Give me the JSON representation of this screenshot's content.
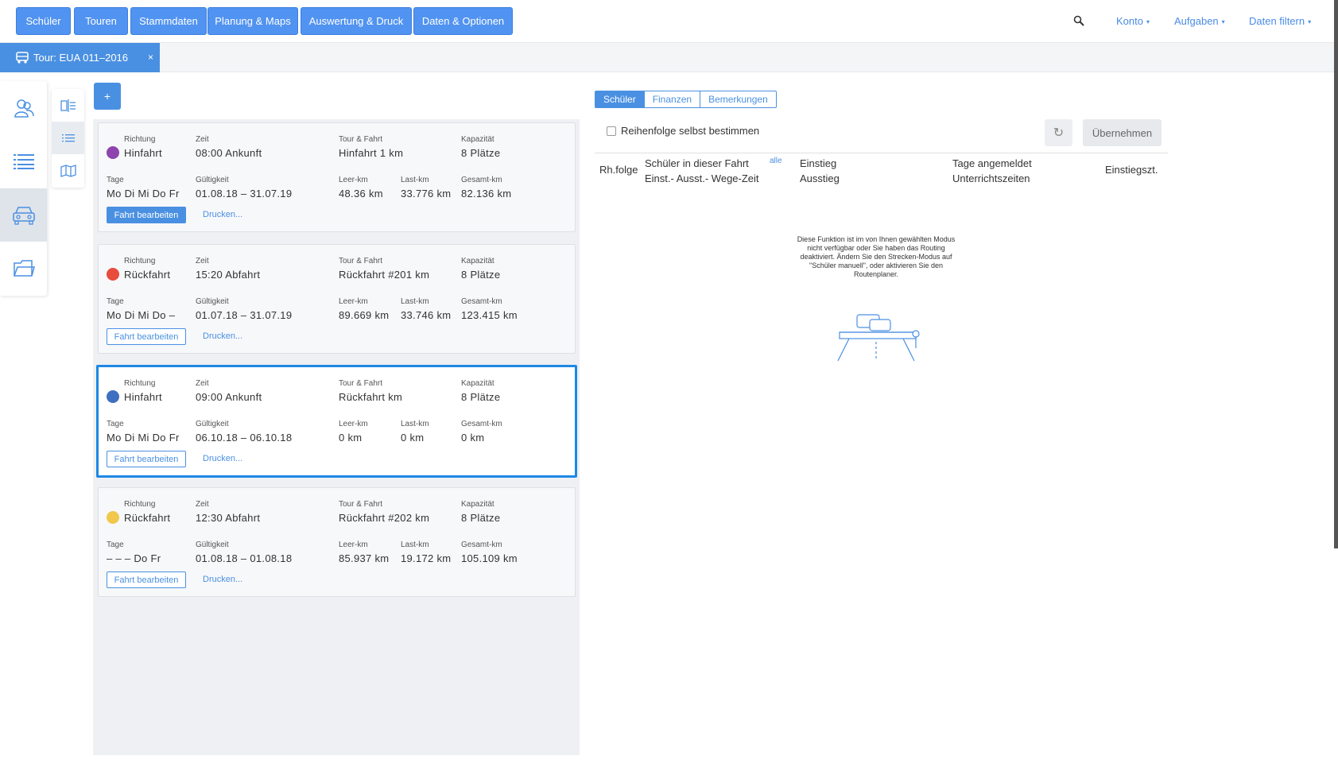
{
  "nav": {
    "buttons": [
      "Schüler",
      "Touren",
      "Stammdaten",
      "Planung & Maps",
      "Auswertung & Druck",
      "Daten & Optionen"
    ],
    "links": [
      "Konto",
      "Aufgaben",
      "Daten filtern"
    ],
    "caret": "▾"
  },
  "tab": {
    "label": "Tour: EUA 011–2016",
    "close": "×"
  },
  "add_label": "+",
  "labels": {
    "richtung": "Richtung",
    "zeit": "Zeit",
    "tour": "Tour & Fahrt",
    "kapazitaet": "Kapazität",
    "tage": "Tage",
    "gueltigkeit": "Gültigkeit",
    "leer": "Leer-km",
    "last": "Last-km",
    "gesamt": "Gesamt-km",
    "edit": "Fahrt bearbeiten",
    "print": "Drucken..."
  },
  "trips": [
    {
      "richtung": "Hinfahrt",
      "zeit": "08:00 Ankunft",
      "tour": "Hinfahrt 1 km",
      "kapazitaet": "8 Plätze",
      "tage": "Mo Di Mi Do Fr",
      "gueltigkeit": "01.08.18 – 31.07.19",
      "leer": "48.36 km",
      "last": "33.776 km",
      "gesamt": "82.136 km",
      "color": "#8e44ad"
    },
    {
      "richtung": "Rückfahrt",
      "zeit": "15:20 Abfahrt",
      "tour": "Rückfahrt #201 km",
      "kapazitaet": "8 Plätze",
      "tage": "Mo Di Mi Do –",
      "gueltigkeit": "01.07.18 – 31.07.19",
      "leer": "89.669 km",
      "last": "33.746 km",
      "gesamt": "123.415 km",
      "color": "#e74c3c"
    },
    {
      "richtung": "Hinfahrt",
      "zeit": "09:00 Ankunft",
      "tour": "Rückfahrt km",
      "kapazitaet": "8 Plätze",
      "tage": "Mo Di Mi Do Fr",
      "gueltigkeit": "06.10.18 – 06.10.18",
      "leer": "0 km",
      "last": "0 km",
      "gesamt": "0 km",
      "color": "#3f6fc0"
    },
    {
      "richtung": "Rückfahrt",
      "zeit": "12:30 Abfahrt",
      "tour": "Rückfahrt #202 km",
      "kapazitaet": "8 Plätze",
      "tage": "– – – Do Fr",
      "gueltigkeit": "01.08.18 – 01.08.18",
      "leer": "85.937 km",
      "last": "19.172 km",
      "gesamt": "105.109 km",
      "color": "#f1c84b"
    }
  ],
  "right": {
    "tabs": [
      "Schüler",
      "Finanzen",
      "Bemerkungen"
    ],
    "checkbox_label": "Reihenfolge selbst bestimmen",
    "refresh": "↻",
    "apply": "Übernehmen",
    "headers": {
      "rh": "Rh.folge",
      "schueler": "Schüler in dieser Fahrt",
      "alle": "alle",
      "einst": "Einst.- Ausst.- Wege-Zeit",
      "einstieg": "Einstieg",
      "ausstieg": "Ausstieg",
      "tage": "Tage angemeldet",
      "unterricht": "Unterrichtszeiten",
      "einstiegszt": "Einstiegszt."
    },
    "info_lines": [
      "Diese Funktion ist im von Ihnen gewählten Modus",
      "nicht verfügbar oder Sie haben das Routing",
      "deaktiviert. Ändern Sie den Strecken-Modus auf",
      "\"Schüler manuell\", oder aktivieren Sie den",
      "Routenplaner."
    ]
  }
}
